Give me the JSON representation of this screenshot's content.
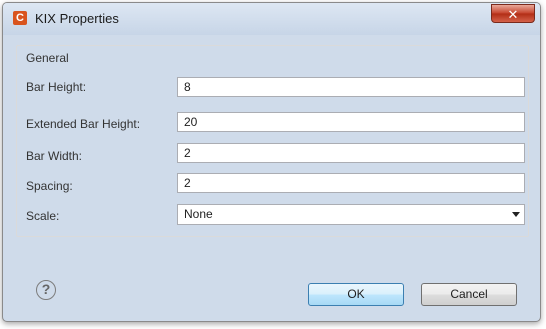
{
  "window": {
    "title": "KIX Properties",
    "icon_letter": "C",
    "close_glyph": "✕"
  },
  "group": {
    "title": "General"
  },
  "fields": [
    {
      "label": "Bar Height:",
      "value": "8"
    },
    {
      "label": "Extended Bar Height:",
      "value": "20"
    },
    {
      "label": "Bar Width:",
      "value": "2"
    },
    {
      "label": "Spacing:",
      "value": "2"
    },
    {
      "label": "Scale:",
      "value": "None"
    }
  ],
  "buttons": {
    "ok": "OK",
    "cancel": "Cancel",
    "help_glyph": "?"
  },
  "icons": {
    "app": "app-logo-icon",
    "close": "close-icon",
    "help": "help-icon",
    "dropdown": "chevron-down-icon"
  }
}
